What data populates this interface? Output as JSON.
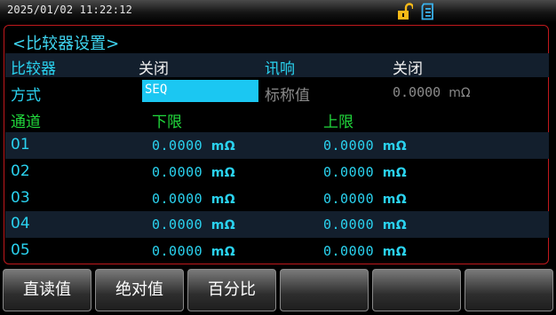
{
  "status_bar": {
    "datetime": "2025/01/02  11:22:12",
    "icons": [
      "unlock-icon",
      "storage-icon"
    ]
  },
  "page": {
    "title": "<比较器设置>"
  },
  "settings": {
    "comparator_label": "比较器",
    "comparator_value": "关闭",
    "beep_label": "讯响",
    "beep_value": "关闭",
    "mode_label": "方式",
    "mode_value": "SEQ",
    "nominal_label": "标称值",
    "nominal_value": "0.0000",
    "nominal_unit": "mΩ"
  },
  "table": {
    "headers": [
      "通道",
      "下限",
      "上限"
    ],
    "rows": [
      {
        "channel": "01",
        "lower": "0.0000",
        "lower_unit": "mΩ",
        "upper": "0.0000",
        "upper_unit": "mΩ"
      },
      {
        "channel": "02",
        "lower": "0.0000",
        "lower_unit": "mΩ",
        "upper": "0.0000",
        "upper_unit": "mΩ"
      },
      {
        "channel": "03",
        "lower": "0.0000",
        "lower_unit": "mΩ",
        "upper": "0.0000",
        "upper_unit": "mΩ"
      },
      {
        "channel": "04",
        "lower": "0.0000",
        "lower_unit": "mΩ",
        "upper": "0.0000",
        "upper_unit": "mΩ"
      },
      {
        "channel": "05",
        "lower": "0.0000",
        "lower_unit": "mΩ",
        "upper": "0.0000",
        "upper_unit": "mΩ"
      }
    ]
  },
  "softkeys": [
    "直读值",
    "绝对值",
    "百分比",
    "",
    "",
    ""
  ],
  "colors": {
    "accent_cyan": "#2ad2ef",
    "header_green": "#21d83c",
    "border_red": "#c0181c",
    "selection_blue": "#1bc7f2"
  }
}
